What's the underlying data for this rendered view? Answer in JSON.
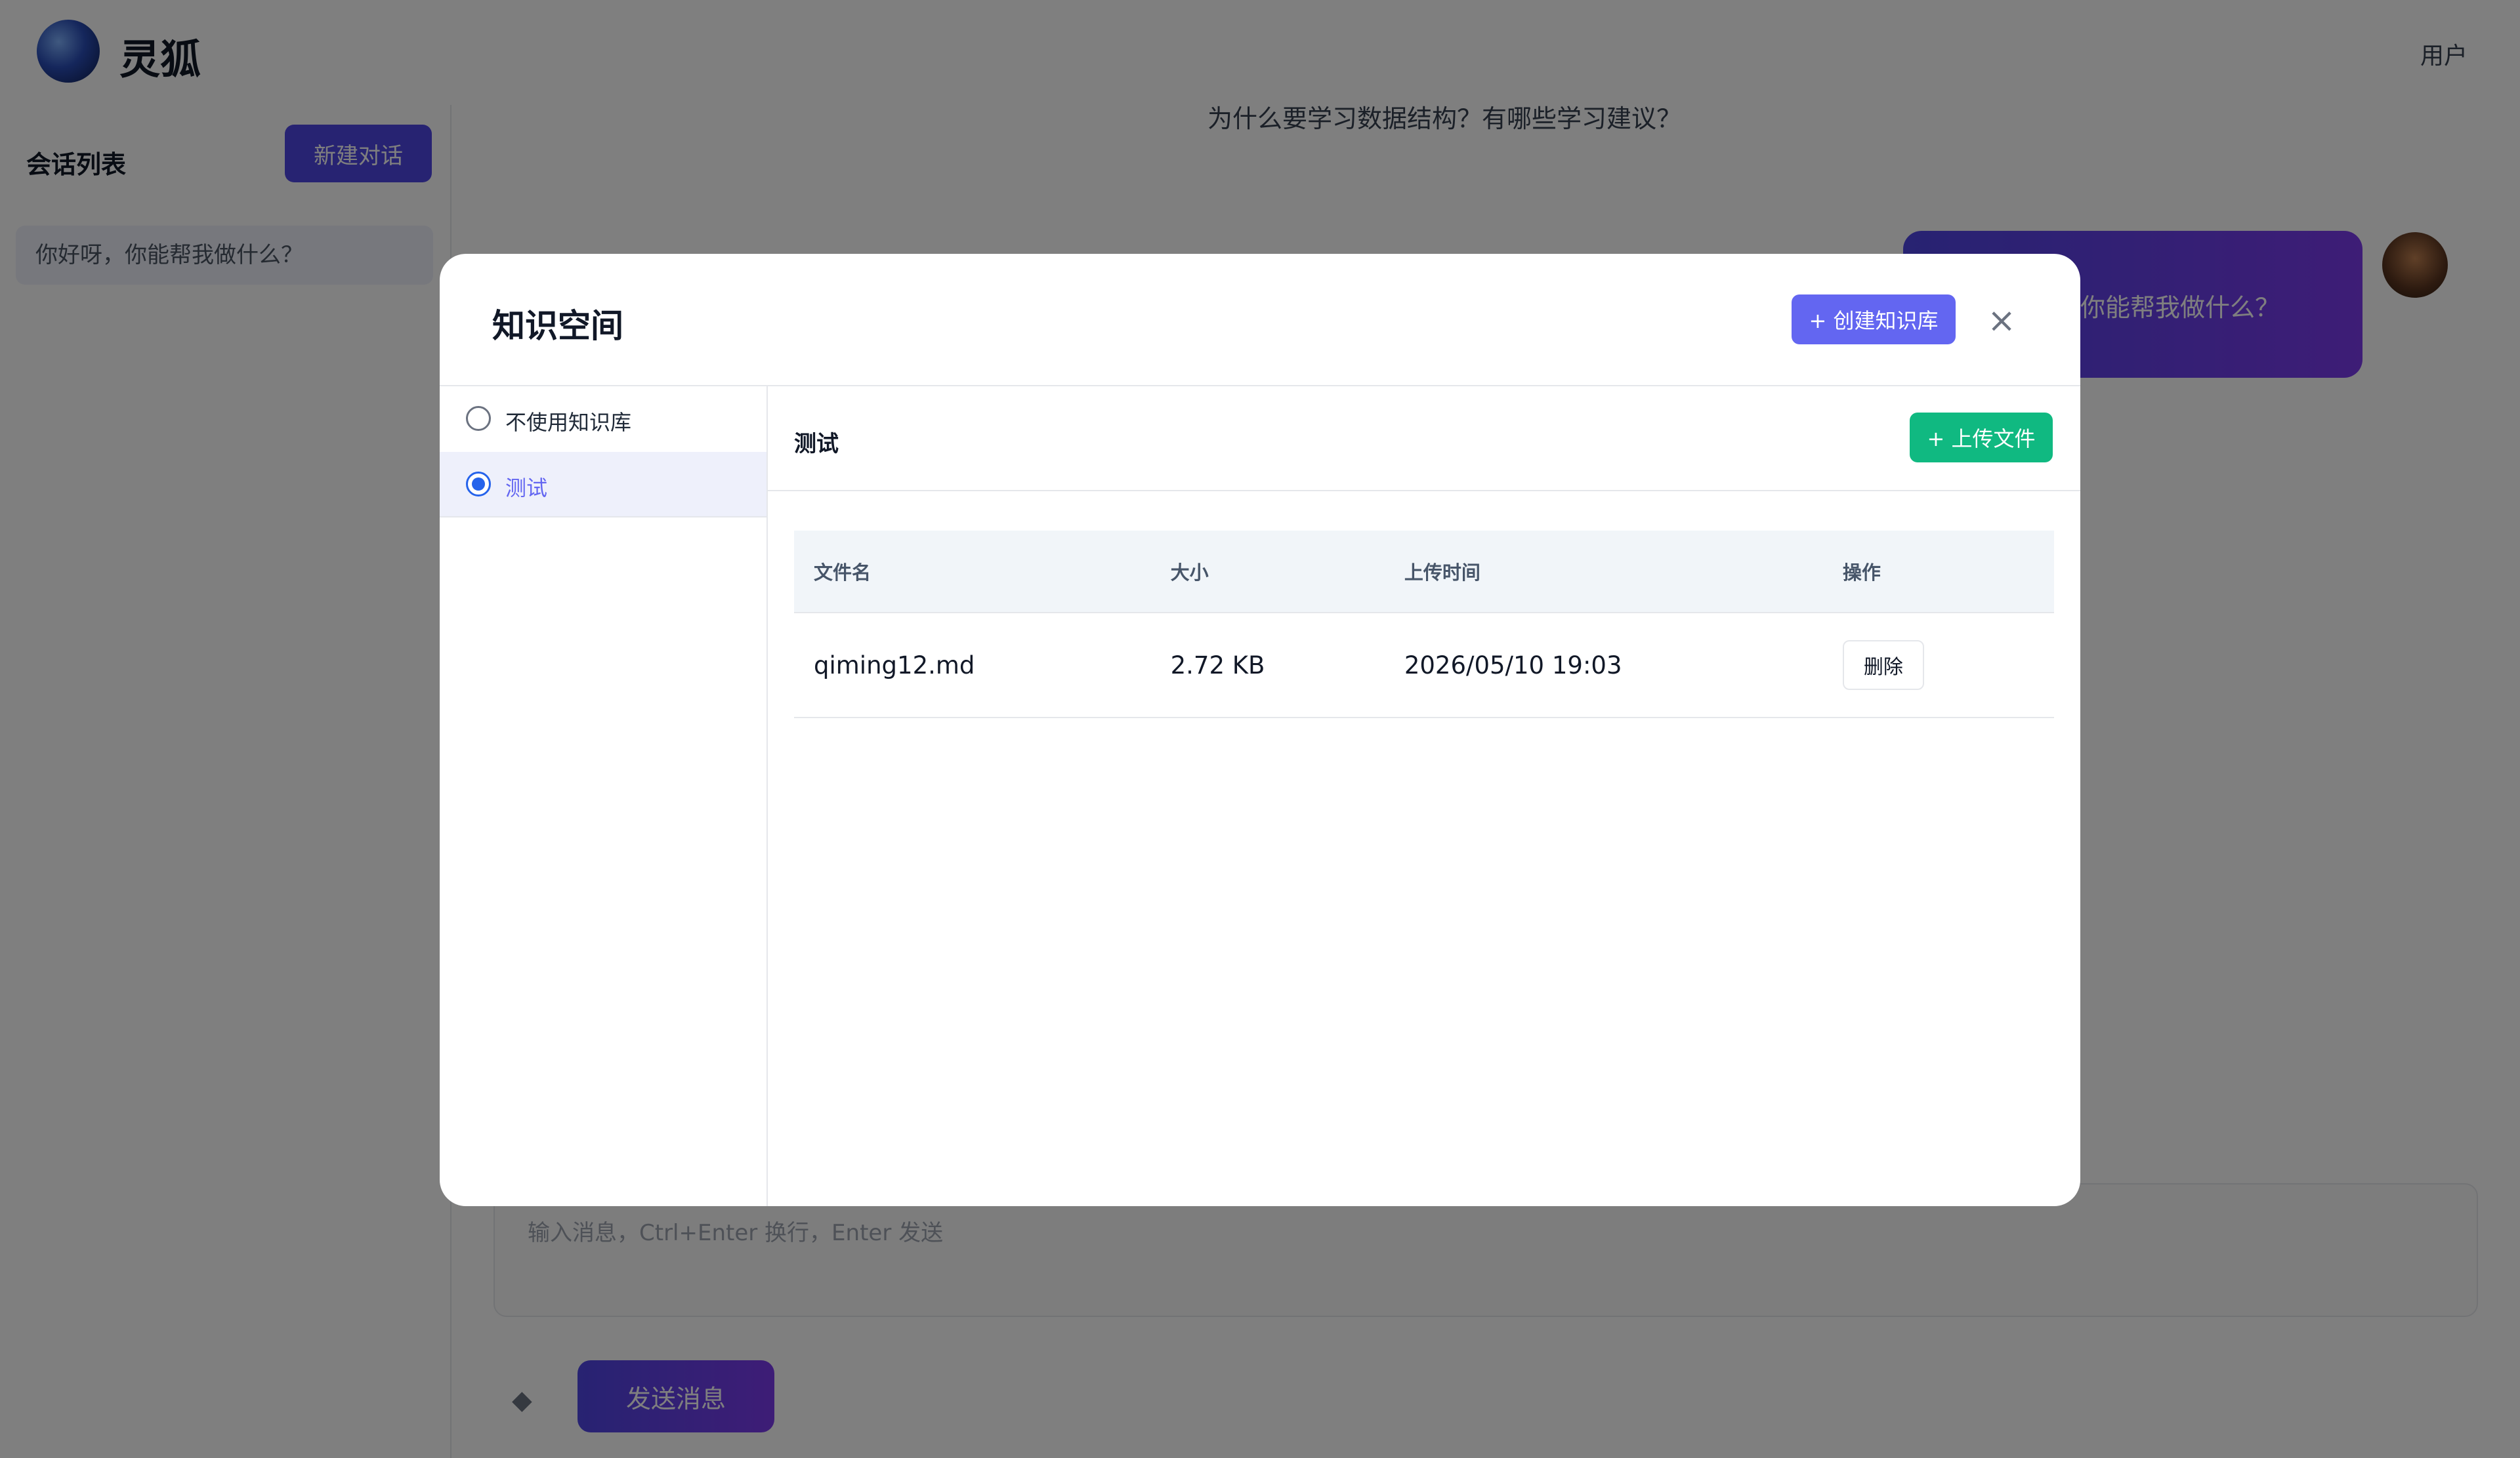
{
  "background": {
    "brand": "灵狐",
    "user_name": "用户",
    "top_question": "为什么要学习数据结构？有哪些学习建议？",
    "sidebar": {
      "title": "会话列表",
      "new_chat_label": "新建对话",
      "conversation_label": "你好呀，你能帮我做什么？"
    },
    "user_message": "你能帮我做什么？",
    "composer_placeholder": "输入消息，Ctrl+Enter 换行，Enter 发送",
    "attach_icon": "attach-icon",
    "send_label": "发送消息"
  },
  "modal": {
    "title": "知识空间",
    "create_kb_label": "+ 创建知识库",
    "close_label": "×",
    "kb_options": [
      {
        "label": "不使用知识库",
        "selected": false
      },
      {
        "label": "测试",
        "selected": true
      }
    ],
    "current_kb_name": "测试",
    "upload_label": "+ 上传文件",
    "table": {
      "columns": [
        "文件名",
        "大小",
        "上传时间",
        "操作"
      ],
      "rows": [
        {
          "name": "qiming12.md",
          "size": "2.72 KB",
          "time": "2026/05/10 19:03",
          "action": "删除"
        }
      ]
    }
  },
  "colors": {
    "primary": "#6366f1",
    "success": "#10b981",
    "radio_checked": "#2563eb",
    "overlay": "rgba(0,0,0,0.5)"
  }
}
